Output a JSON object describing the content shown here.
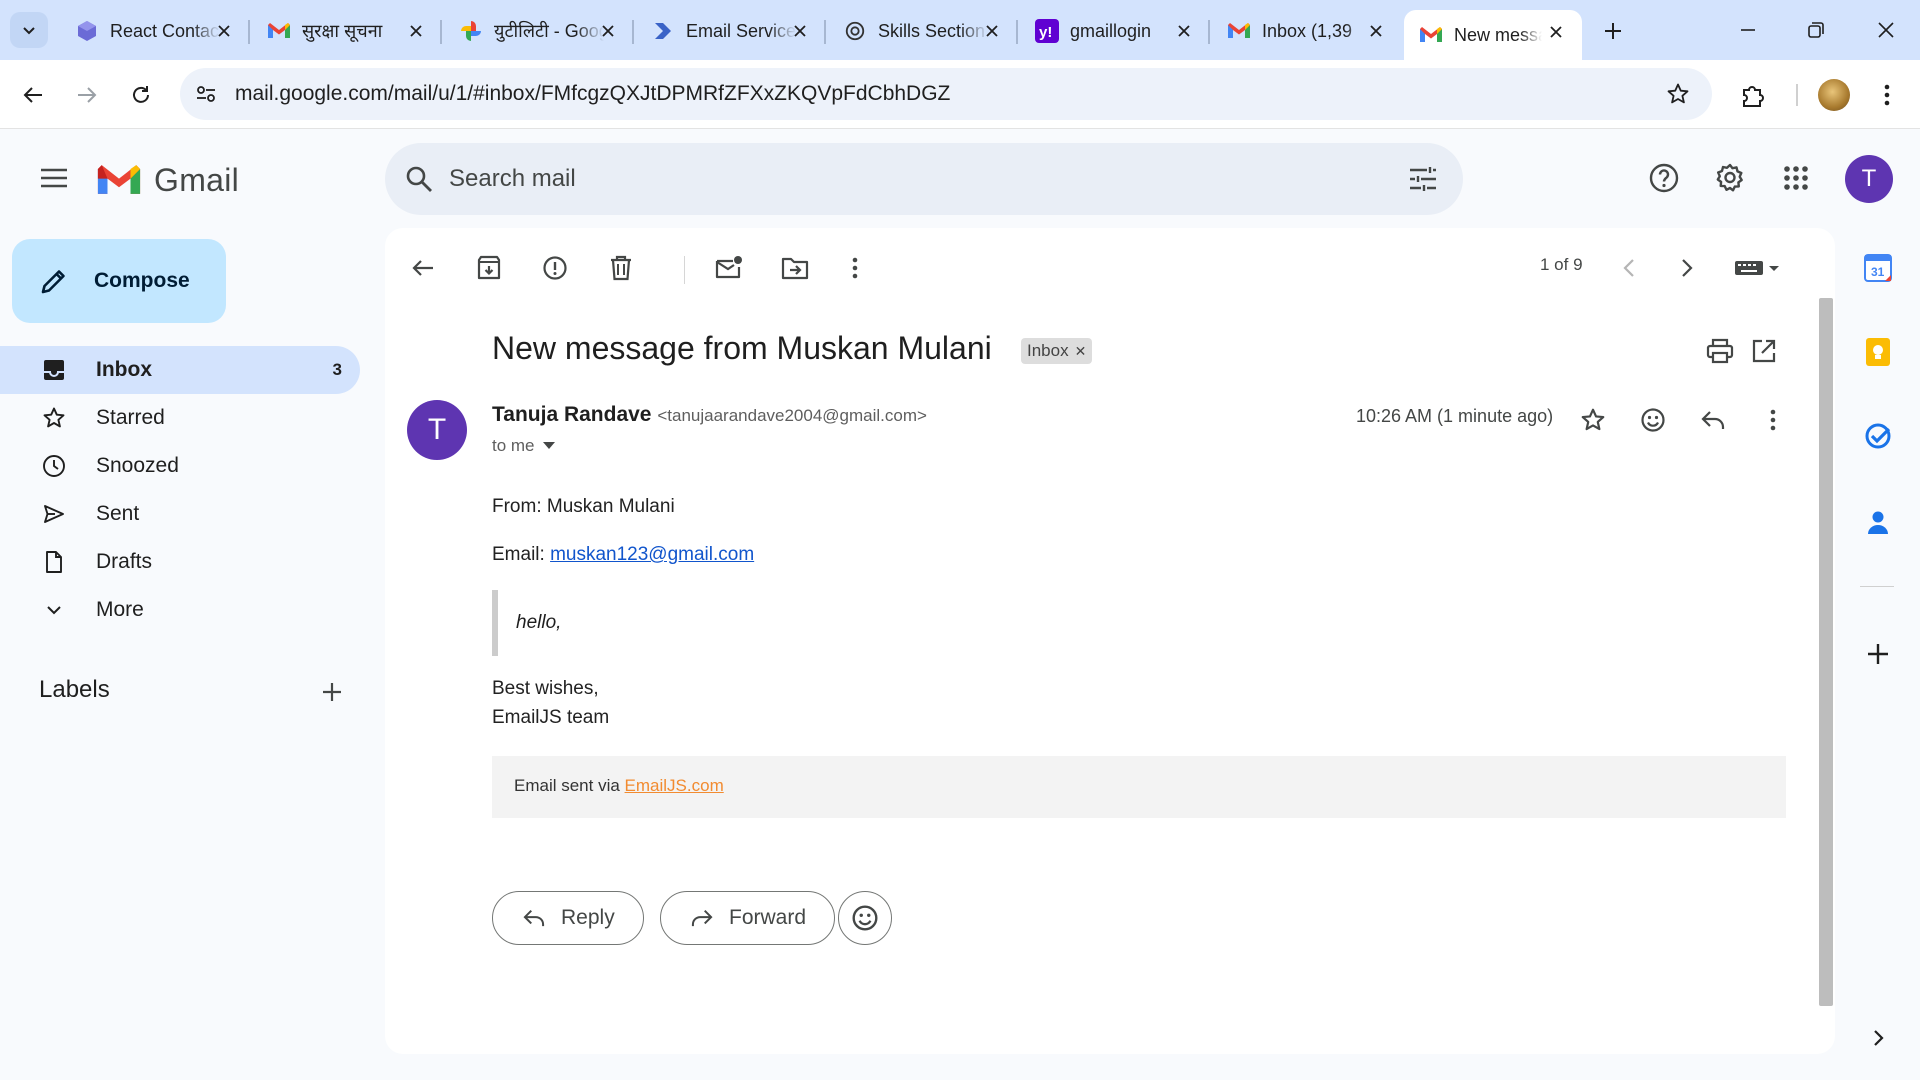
{
  "browser": {
    "tabs": [
      {
        "title": "React Contact Form",
        "favicon": "react-cube-icon"
      },
      {
        "title": "सुरक्षा सूचना",
        "favicon": "gmail-icon"
      },
      {
        "title": "युटीलिटी - Google",
        "favicon": "google-photos-icon"
      },
      {
        "title": "Email Services",
        "favicon": "emailjs-icon"
      },
      {
        "title": "Skills Section",
        "favicon": "openai-icon"
      },
      {
        "title": "gmaillogin",
        "favicon": "yahoo-icon"
      },
      {
        "title": "Inbox (1,39",
        "favicon": "gmail-icon"
      },
      {
        "title": "New message from Muskan Mulani",
        "favicon": "gmail-icon"
      }
    ],
    "url": "mail.google.com/mail/u/1/#inbox/FMfcgzQXJtDPMRfZFXxZKQVpFdCbhDGZ"
  },
  "gmail": {
    "brand": "Gmail",
    "search_placeholder": "Search mail",
    "account_initial": "T",
    "compose_label": "Compose",
    "nav": [
      {
        "label": "Inbox",
        "count": "3",
        "icon": "inbox-icon"
      },
      {
        "label": "Starred",
        "count": "",
        "icon": "star-icon"
      },
      {
        "label": "Snoozed",
        "count": "",
        "icon": "clock-icon"
      },
      {
        "label": "Sent",
        "count": "",
        "icon": "send-icon"
      },
      {
        "label": "Drafts",
        "count": "",
        "icon": "draft-icon"
      },
      {
        "label": "More",
        "count": "",
        "icon": "chevron-down-icon"
      }
    ],
    "labels_heading": "Labels"
  },
  "message": {
    "pager": "1 of 9",
    "subject": "New message from Muskan Mulani",
    "label_chip": "Inbox",
    "sender_initial": "T",
    "sender_name": "Tanuja Randave",
    "sender_email": "<tanujaarandave2004@gmail.com>",
    "to": "to me",
    "time": "10:26 AM (1 minute ago)",
    "body": {
      "from_line": "From: Muskan Mulani",
      "email_prefix": "Email: ",
      "email_link": "muskan123@gmail.com",
      "quote": "hello,",
      "signoff": "Best wishes,",
      "team": "EmailJS team",
      "footer_prefix": "Email sent via ",
      "footer_link": "EmailJS.com"
    },
    "reply_label": "Reply",
    "forward_label": "Forward"
  },
  "colors": {
    "tabstrip": "#d3e3fd",
    "compose": "#c2e7ff",
    "avatar": "#5e35b1",
    "link": "#1155cc",
    "emailjs_link": "#f28b30"
  }
}
